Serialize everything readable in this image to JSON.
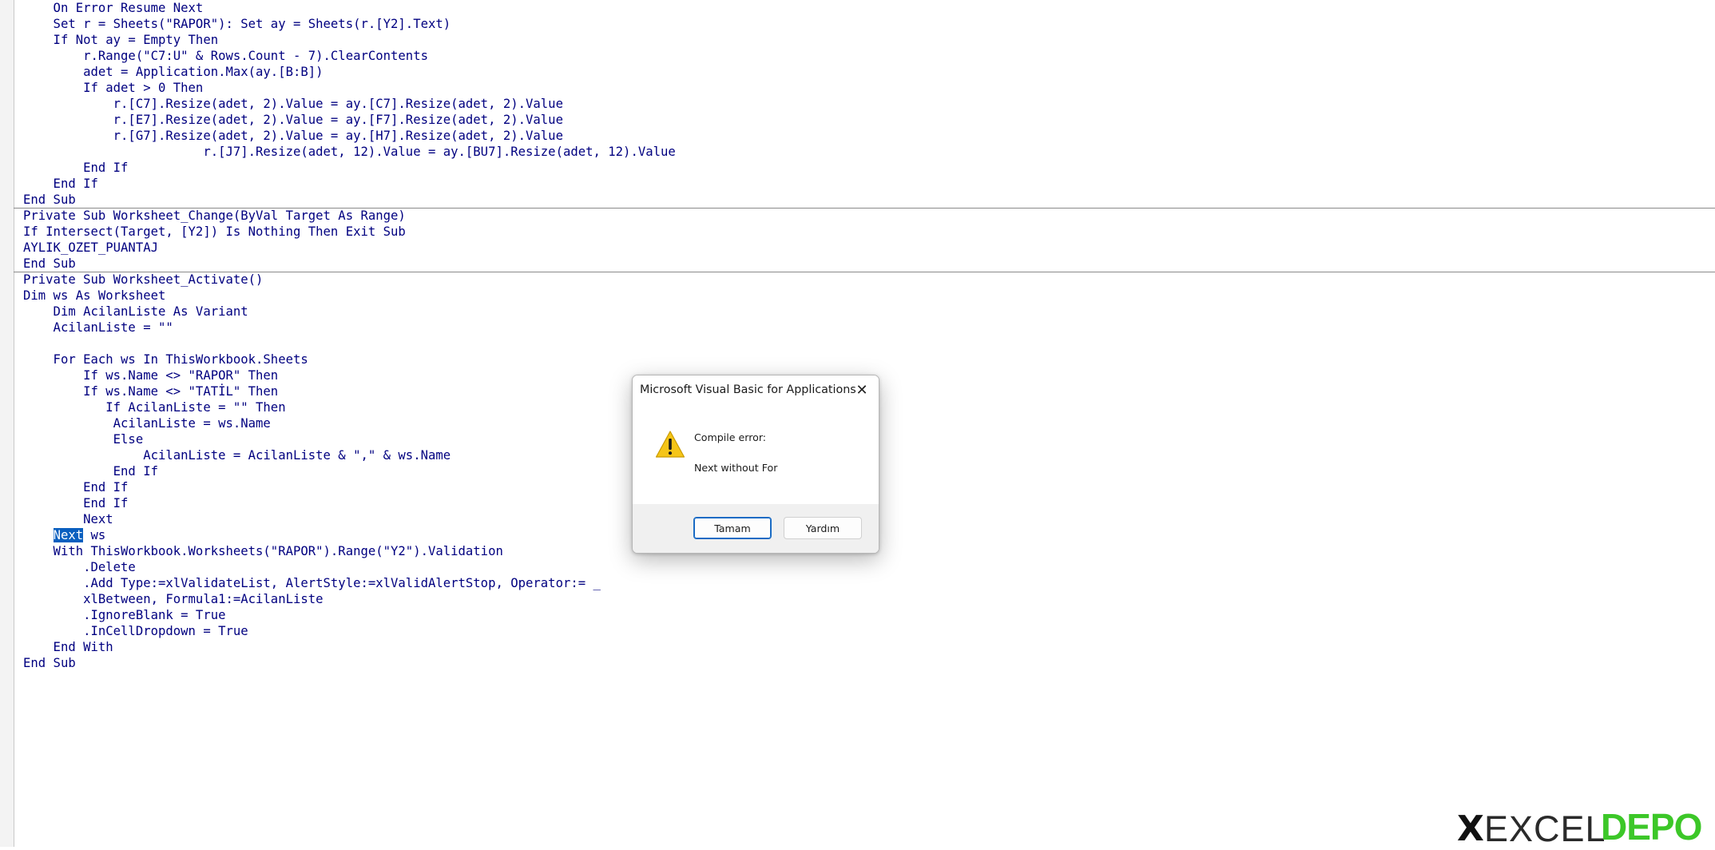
{
  "editor": {
    "code_lines": [
      "    On Error Resume Next",
      "    Set r = Sheets(\"RAPOR\"): Set ay = Sheets(r.[Y2].Text)",
      "    If Not ay = Empty Then",
      "        r.Range(\"C7:U\" & Rows.Count - 7).ClearContents",
      "        adet = Application.Max(ay.[B:B])",
      "        If adet > 0 Then",
      "            r.[C7].Resize(adet, 2).Value = ay.[C7].Resize(adet, 2).Value",
      "            r.[E7].Resize(adet, 2).Value = ay.[F7].Resize(adet, 2).Value",
      "            r.[G7].Resize(adet, 2).Value = ay.[H7].Resize(adet, 2).Value",
      "                        r.[J7].Resize(adet, 12).Value = ay.[BU7].Resize(adet, 12).Value",
      "        End If",
      "    End If",
      "End Sub",
      "Private Sub Worksheet_Change(ByVal Target As Range)",
      "If Intersect(Target, [Y2]) Is Nothing Then Exit Sub",
      "AYLIK_OZET_PUANTAJ",
      "End Sub",
      "Private Sub Worksheet_Activate()",
      "Dim ws As Worksheet",
      "    Dim AcilanListe As Variant",
      "    AcilanListe = \"\"",
      "",
      "    For Each ws In ThisWorkbook.Sheets",
      "        If ws.Name <> \"RAPOR\" Then",
      "        If ws.Name <> \"TATİL\" Then",
      "           If AcilanListe = \"\" Then",
      "            AcilanListe = ws.Name",
      "            Else",
      "                AcilanListe = AcilanListe & \",\" & ws.Name",
      "            End If",
      "        End If",
      "        End If",
      "        Next",
      "    ",
      "    With ThisWorkbook.Worksheets(\"RAPOR\").Range(\"Y2\").Validation",
      "        .Delete",
      "        .Add Type:=xlValidateList, AlertStyle:=xlValidAlertStop, Operator:= _",
      "        xlBetween, Formula1:=AcilanListe",
      "        .IgnoreBlank = True",
      "        .InCellDropdown = True",
      "    End With",
      "End Sub"
    ],
    "highlight_line": {
      "indent": "    ",
      "selected": "Next",
      "rest": " ws"
    }
  },
  "dialog": {
    "title": "Microsoft Visual Basic for Applications",
    "close_symbol": "✕",
    "message_line_1": "Compile error:",
    "message_line_2": "Next without For",
    "ok_label": "Tamam",
    "help_label": "Yardım"
  },
  "watermark": {
    "x": "X",
    "excel": "EXCEL",
    "depo": "DEPO"
  },
  "colors": {
    "code_text": "#000080",
    "selection": "#0a5fbf",
    "warning": "#f5c518",
    "watermark_green": "#3cc728"
  }
}
